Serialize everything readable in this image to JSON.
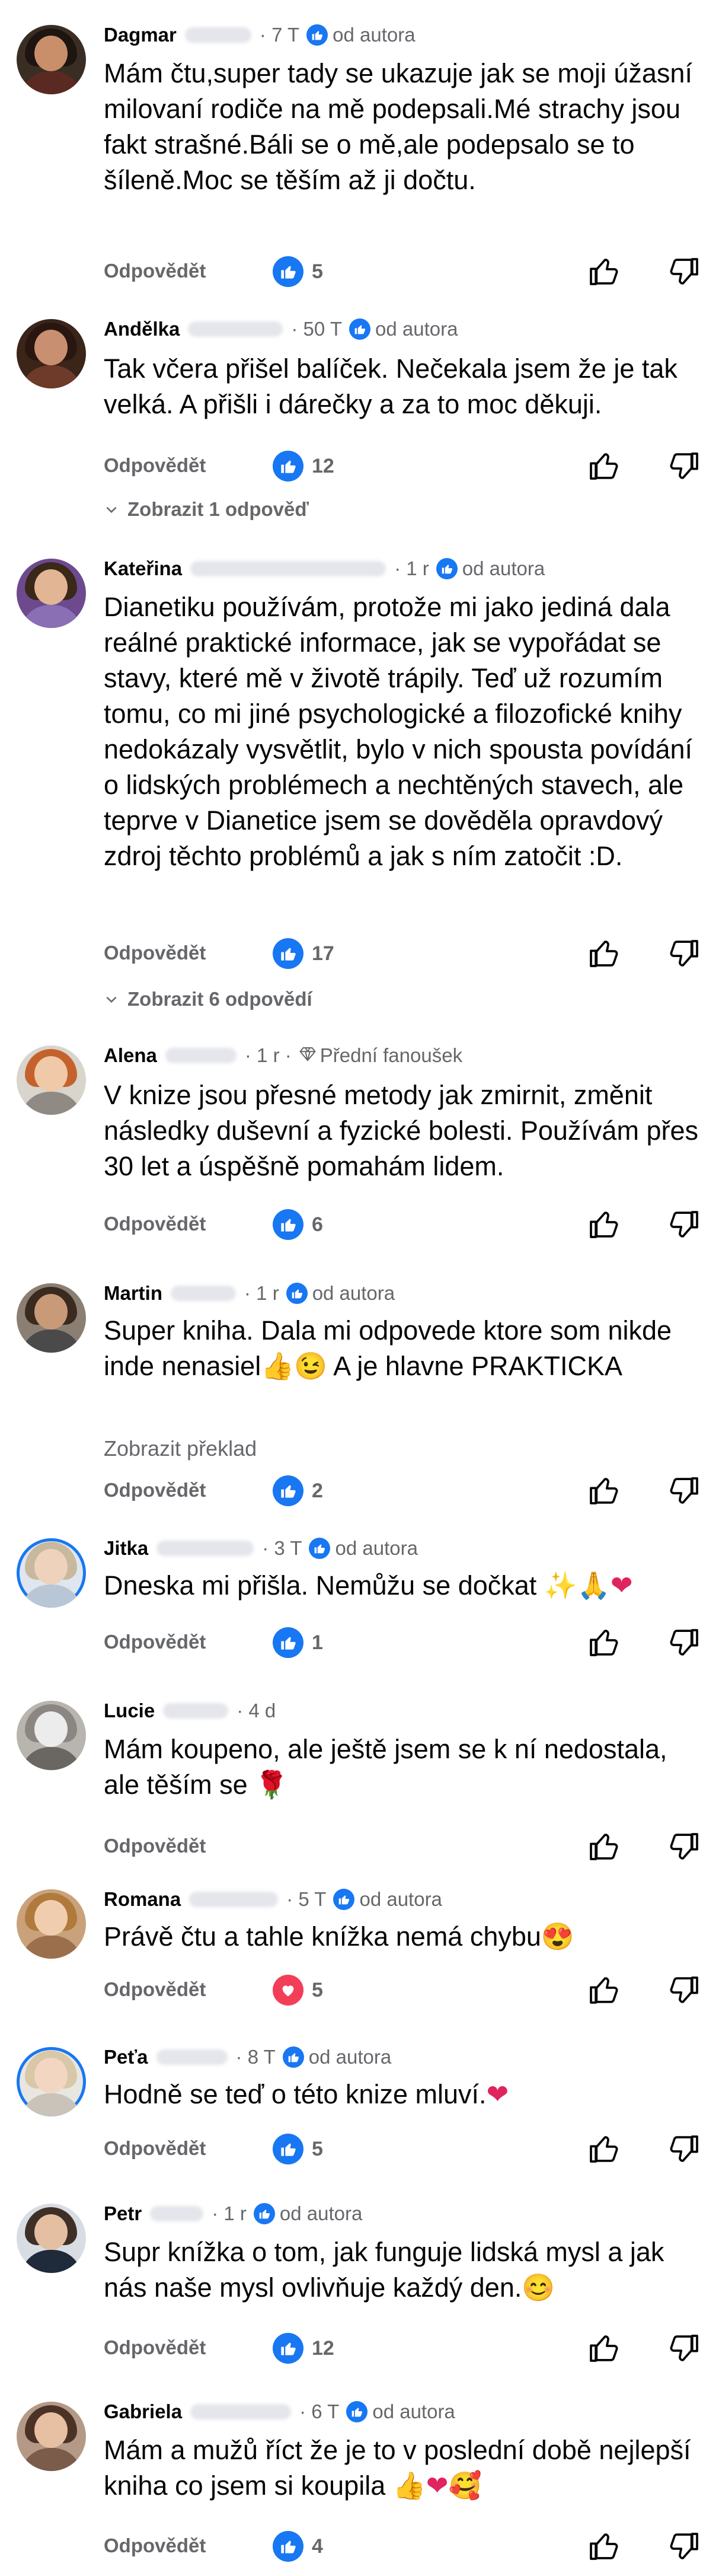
{
  "labels": {
    "reply": "Odpovědět",
    "from_author": "od autora",
    "top_fan": "Přední fanoušek",
    "show_translation": "Zobrazit překlad"
  },
  "comments": [
    {
      "name": "Dagmar",
      "time": "7 T",
      "badge": "author",
      "text": "Mám čtu,super tady se ukazuje jak se moji úžasní milovaní rodiče na mě podepsali.Mé strachy jsou fakt strašné.Báli se o mě,ale podepsalo se to šíleně.Moc se těším až ji dočtu.",
      "reaction": "like",
      "count": "5"
    },
    {
      "name": "Andělka",
      "time": "50 T",
      "badge": "author",
      "text": "Tak včera přišel balíček. Nečekala jsem že je tak velká. A přišli i dárečky a za to moc děkuji.",
      "reaction": "like",
      "count": "12",
      "replies_label": "Zobrazit 1 odpověď"
    },
    {
      "name": "Kateřina",
      "time": "1 r",
      "badge": "author",
      "text": "Dianetiku používám, protože mi jako jediná dala reálné praktické informace, jak se vypořádat se stavy, které mě v životě trápily. Teď už rozumím tomu, co mi jiné psychologické a filozofické knihy nedokázaly vysvětlit, bylo v nich spousta povídání o lidských problémech a nechtěných stavech, ale teprve v Dianetice jsem se dověděla opravdový zdroj těchto problémů a jak s ním zatočit :D.",
      "reaction": "like",
      "count": "17",
      "replies_label": "Zobrazit 6 odpovědí"
    },
    {
      "name": "Alena",
      "time": "1 r",
      "badge": "fan",
      "text": "V knize jsou přesné metody jak zmirnit, změnit následky duševní a fyzické bolesti. Používám přes 30 let a úspěšně pomahám lidem.",
      "reaction": "like",
      "count": "6"
    },
    {
      "name": "Martin",
      "time": "1 r",
      "badge": "author",
      "text": "Super kniha. Dala mi odpovede ktore som nikde inde nenasiel",
      "emoji": "👍😉",
      "text_after": " A je hlavne PRAKTICKA",
      "reaction": "like",
      "count": "2"
    },
    {
      "name": "Jitka",
      "time": "3 T",
      "badge": "author",
      "text": "Dneska mi přišla. Nemůžu se dočkat ",
      "emoji": "✨🙏❤",
      "reaction": "like",
      "count": "1"
    },
    {
      "name": "Lucie",
      "time": "4 d",
      "badge": "",
      "text": "Mám koupeno, ale ještě jsem se k ní nedostala, ale těším se ",
      "emoji": "🌹",
      "reaction": "",
      "count": ""
    },
    {
      "name": "Romana",
      "time": "5 T",
      "badge": "author",
      "text": "Právě čtu a tahle knížka nemá chybu",
      "emoji": "😍",
      "reaction": "love",
      "count": "5"
    },
    {
      "name": "Peťa",
      "time": "8 T",
      "badge": "author",
      "text": "Hodně  se teď  o této knize mluví.",
      "emoji": "❤",
      "reaction": "like",
      "count": "5"
    },
    {
      "name": "Petr",
      "time": "1 r",
      "badge": "author",
      "text": "Supr knížka o tom, jak funguje lidská mysl a jak nás naše mysl ovlivňuje každý den.",
      "emoji": "😊",
      "reaction": "like",
      "count": "12"
    },
    {
      "name": "Gabriela",
      "time": "6 T",
      "badge": "author",
      "text": "Mám a mužů říct že je to v poslední době nejlepší kniha co jsem si koupila ",
      "emoji": "👍❤🥰",
      "reaction": "like",
      "count": "4"
    }
  ],
  "colors": {
    "accent": "#1877f2",
    "love": "#f33e58",
    "muted": "#65676b",
    "text": "#050505"
  },
  "icons": {
    "like": "thumbs-up-icon",
    "love": "heart-icon",
    "up": "thumb-up-outline-icon",
    "down": "thumb-down-outline-icon",
    "chevron": "chevron-down-icon",
    "diamond": "diamond-icon"
  }
}
